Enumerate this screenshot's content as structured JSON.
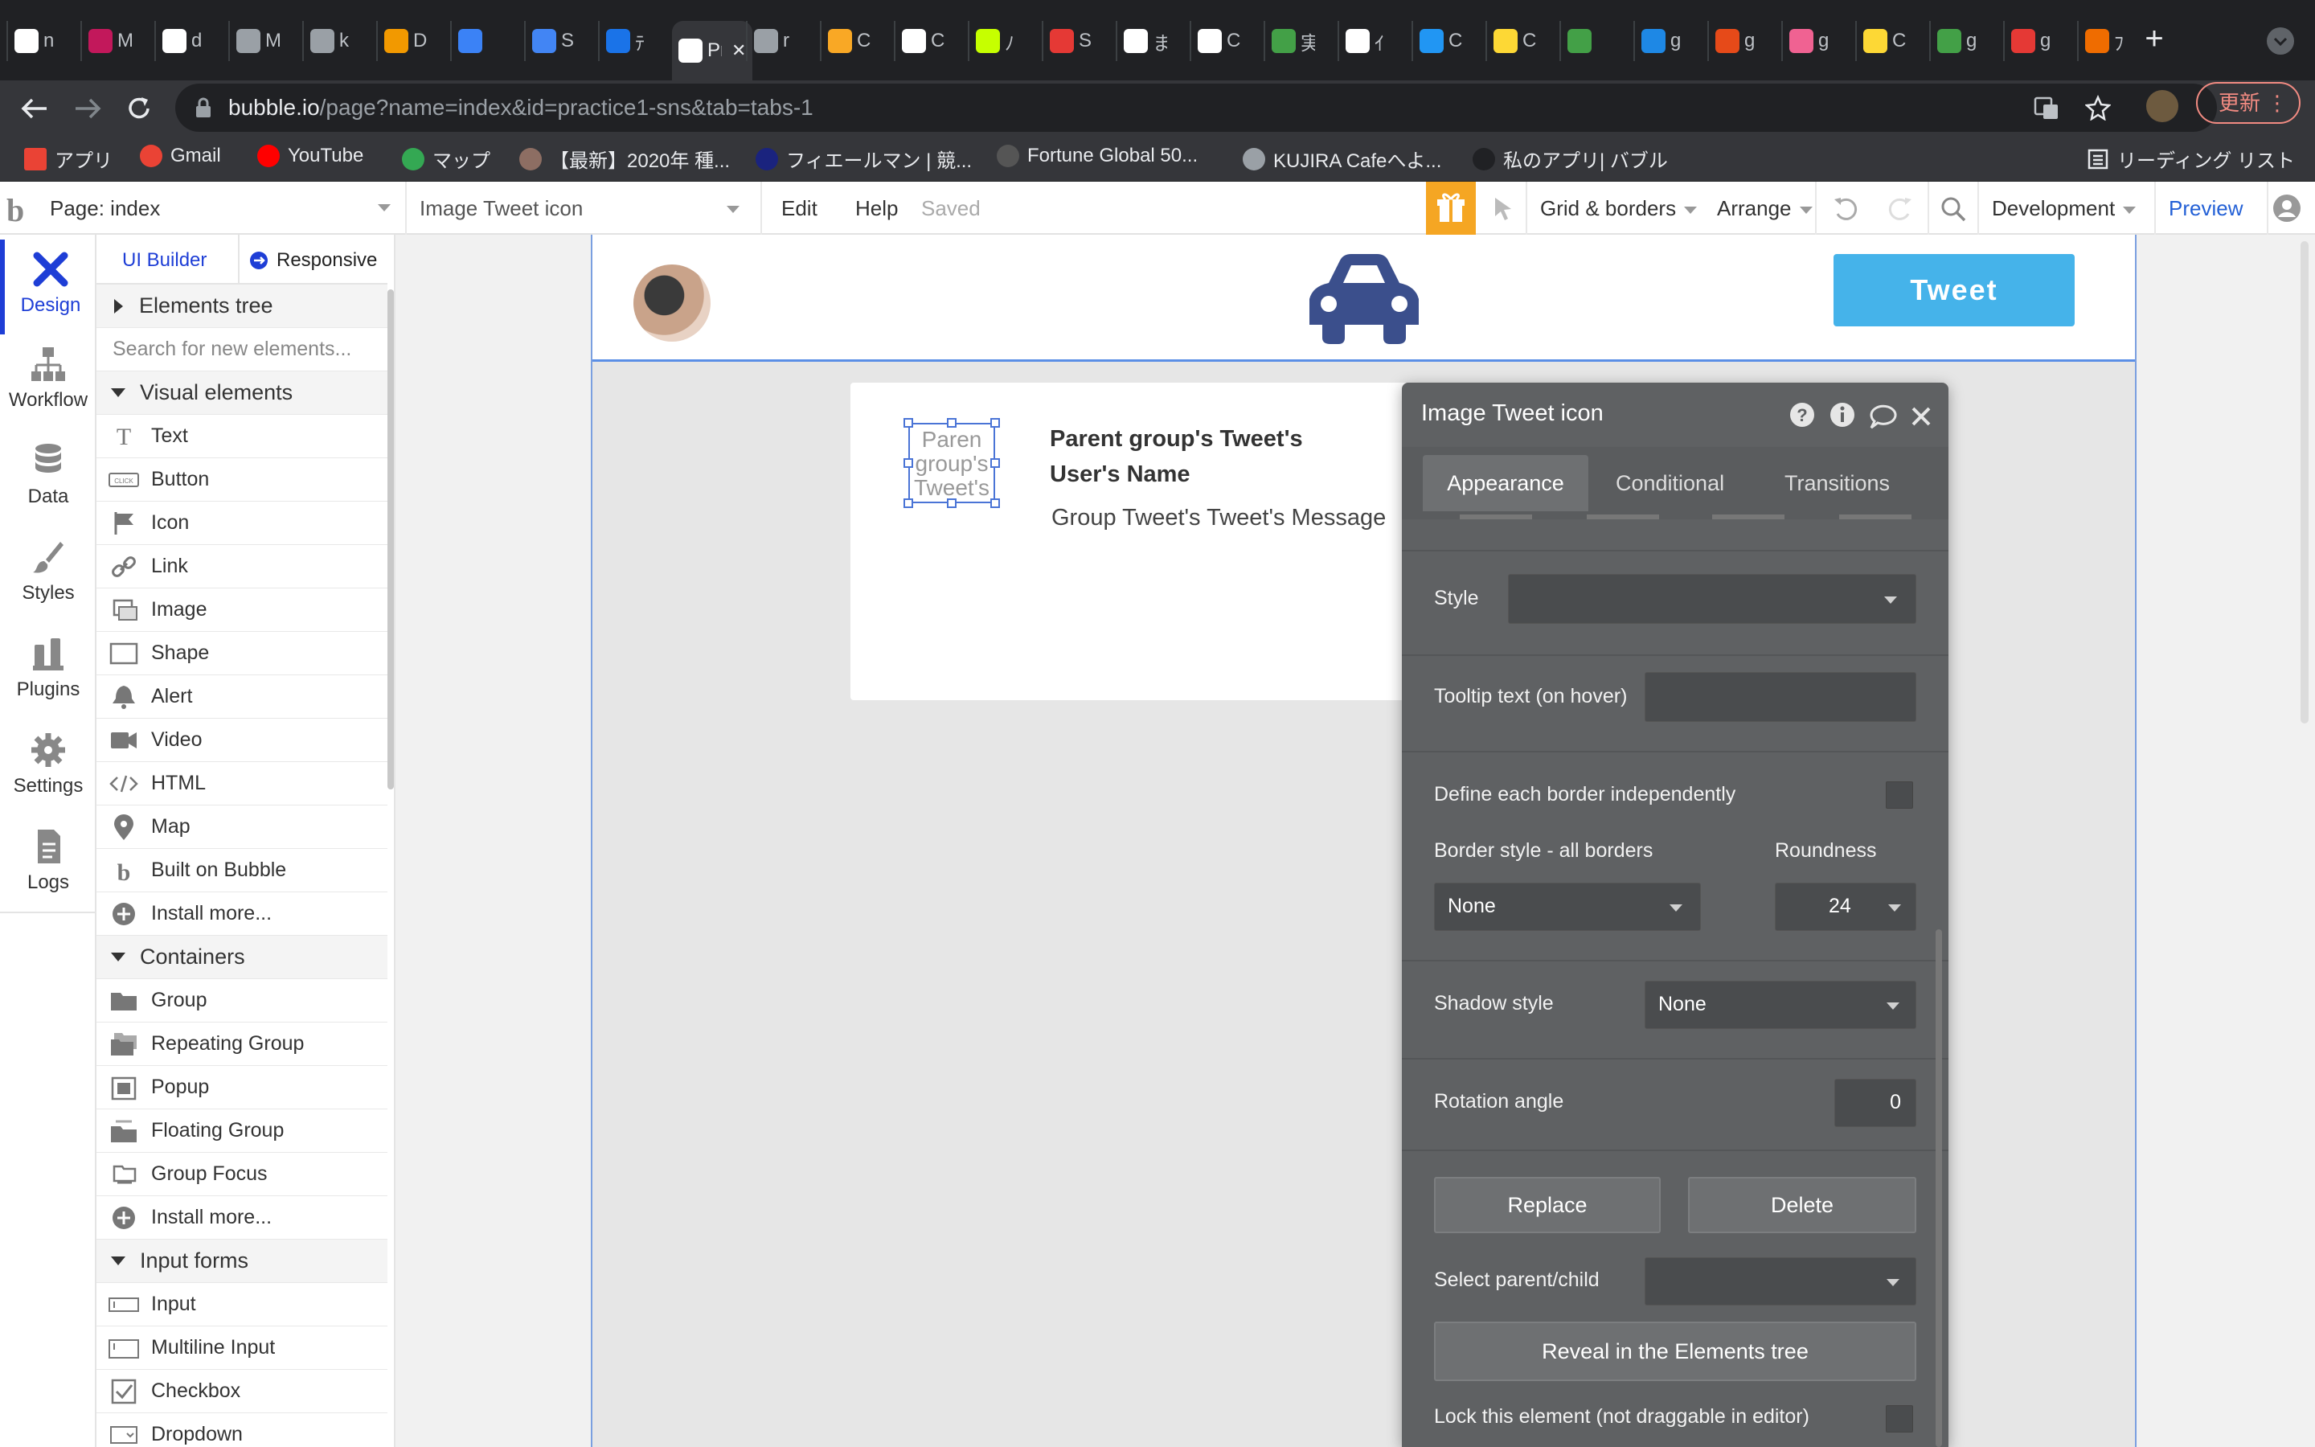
{
  "browser": {
    "tabs": [
      {
        "label": "n",
        "color": "#fff"
      },
      {
        "label": "M",
        "color": "#c2185b"
      },
      {
        "label": "d",
        "color": "#fff"
      },
      {
        "label": "M",
        "color": "#9aa0a6"
      },
      {
        "label": "k",
        "color": "#9aa0a6"
      },
      {
        "label": "D",
        "color": "#f29900"
      },
      {
        "label": "",
        "color": "#3b82f6"
      },
      {
        "label": "S",
        "color": "#4285f4"
      },
      {
        "label": "ﾃ",
        "color": "#1a73e8"
      },
      {
        "label": "Pr",
        "color": "#fff"
      },
      {
        "label": "r",
        "color": "#9aa0a6"
      },
      {
        "label": "C",
        "color": "#f9a825"
      },
      {
        "label": "C",
        "color": "#fff"
      },
      {
        "label": "ﾉ",
        "color": "#c6ff00"
      },
      {
        "label": "S",
        "color": "#e53935"
      },
      {
        "label": "ま",
        "color": "#fff"
      },
      {
        "label": "C",
        "color": "#fff"
      },
      {
        "label": "実",
        "color": "#43a047"
      },
      {
        "label": "ｲ",
        "color": "#fff"
      },
      {
        "label": "C",
        "color": "#2196f3"
      },
      {
        "label": "C",
        "color": "#fdd835"
      },
      {
        "label": "",
        "color": "#43a047"
      },
      {
        "label": "g",
        "color": "#1e88e5"
      },
      {
        "label": "g",
        "color": "#e64a19"
      },
      {
        "label": "g",
        "color": "#f06292"
      },
      {
        "label": "C",
        "color": "#fdd835"
      },
      {
        "label": "g",
        "color": "#43a047"
      },
      {
        "label": "g",
        "color": "#e53935"
      },
      {
        "label": "ﾌ",
        "color": "#ef6c00"
      }
    ],
    "url_domain": "bubble.io",
    "url_path": "/page?name=index&id=practice1-sns&tab=tabs-1",
    "update_button": "更新",
    "bookmarks": [
      {
        "label": "アプリ",
        "color": "#ea4335"
      },
      {
        "label": "Gmail",
        "color": "#ea4335"
      },
      {
        "label": "YouTube",
        "color": "#ff0000"
      },
      {
        "label": "マップ",
        "color": "#34a853"
      },
      {
        "label": "【最新】2020年 種...",
        "color": "#8d6e63"
      },
      {
        "label": "フィエールマン | 競...",
        "color": "#1a237e"
      },
      {
        "label": "Fortune Global 50...",
        "color": "#555"
      },
      {
        "label": "KUJIRA Cafeへよ...",
        "color": "#9aa0a6"
      },
      {
        "label": "私のアプリ| バブル",
        "color": "#202124"
      }
    ],
    "reading_list": "リーディング リスト"
  },
  "topbar": {
    "page_selector": "Page: index",
    "element_selector": "Image Tweet icon",
    "edit": "Edit",
    "help": "Help",
    "saved": "Saved",
    "grid_borders": "Grid & borders",
    "arrange": "Arrange",
    "development": "Development",
    "preview": "Preview",
    "accent": "#f5a623"
  },
  "leftnav": {
    "items": [
      {
        "label": "Design"
      },
      {
        "label": "Workflow"
      },
      {
        "label": "Data"
      },
      {
        "label": "Styles"
      },
      {
        "label": "Plugins"
      },
      {
        "label": "Settings"
      },
      {
        "label": "Logs"
      }
    ]
  },
  "elements_panel": {
    "tab_builder": "UI Builder",
    "tab_responsive": "Responsive",
    "elements_tree": "Elements tree",
    "search_placeholder": "Search for new elements...",
    "visual_header": "Visual elements",
    "visual": [
      "Text",
      "Button",
      "Icon",
      "Link",
      "Image",
      "Shape",
      "Alert",
      "Video",
      "HTML",
      "Map",
      "Built on Bubble",
      "Install more..."
    ],
    "containers_header": "Containers",
    "containers": [
      "Group",
      "Repeating Group",
      "Popup",
      "Floating Group",
      "Group Focus",
      "Install more..."
    ],
    "inputs_header": "Input forms",
    "inputs": [
      "Input",
      "Multiline Input",
      "Checkbox",
      "Dropdown"
    ]
  },
  "canvas": {
    "tweet_button": "Tweet",
    "tweet_button_color": "#45b3ea",
    "car_icon_color": "#3b4f8c",
    "image_placeholder": "Paren group's Tweet's",
    "user_name": "Parent group's Tweet's User's Name",
    "message": "Group Tweet's Tweet's Message"
  },
  "property_editor": {
    "title": "Image Tweet icon",
    "tabs": [
      "Appearance",
      "Conditional",
      "Transitions"
    ],
    "style_label": "Style",
    "tooltip_label": "Tooltip text (on hover)",
    "define_border_label": "Define each border independently",
    "border_style_label": "Border style - all borders",
    "roundness_label": "Roundness",
    "border_style_value": "None",
    "roundness_value": "24",
    "shadow_label": "Shadow style",
    "shadow_value": "None",
    "rotation_label": "Rotation angle",
    "rotation_value": "0",
    "replace_button": "Replace",
    "delete_button": "Delete",
    "select_parent_label": "Select parent/child",
    "reveal_button": "Reveal in the Elements tree",
    "lock_label": "Lock this element (not draggable in editor)"
  }
}
